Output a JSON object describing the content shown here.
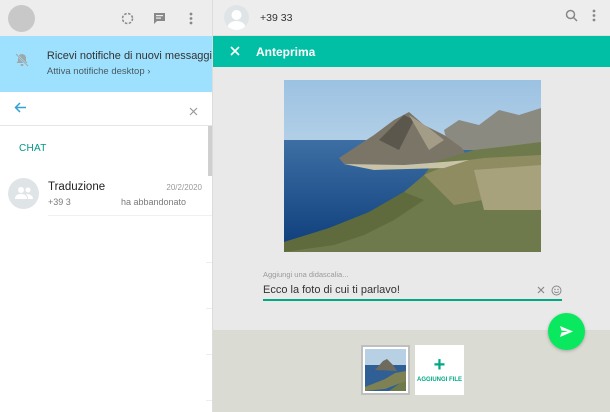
{
  "left": {
    "header": {
      "icons": [
        "status-icon",
        "new-chat-icon",
        "menu-icon"
      ]
    },
    "notification": {
      "title": "Ricevi notifiche di nuovi messaggi",
      "subtitle": "Attiva notifiche desktop"
    },
    "search": {
      "value": ""
    },
    "section_label": "CHAT",
    "chats": [
      {
        "name": "Traduzione",
        "date": "20/2/2020",
        "number": "+39 3",
        "message": "ha abbandonato"
      }
    ]
  },
  "right": {
    "header": {
      "contact": "+39 33"
    },
    "preview": {
      "title": "Anteprima",
      "caption_label": "Aggiungi una didascalia...",
      "caption_value": "Ecco la foto di cui ti parlavo!",
      "add_file_label": "AGGIUNGI FILE"
    }
  },
  "colors": {
    "accent": "#00bfa5",
    "notif_bg": "#9de1fe",
    "send": "#09e85e",
    "teal_text": "#009688"
  }
}
